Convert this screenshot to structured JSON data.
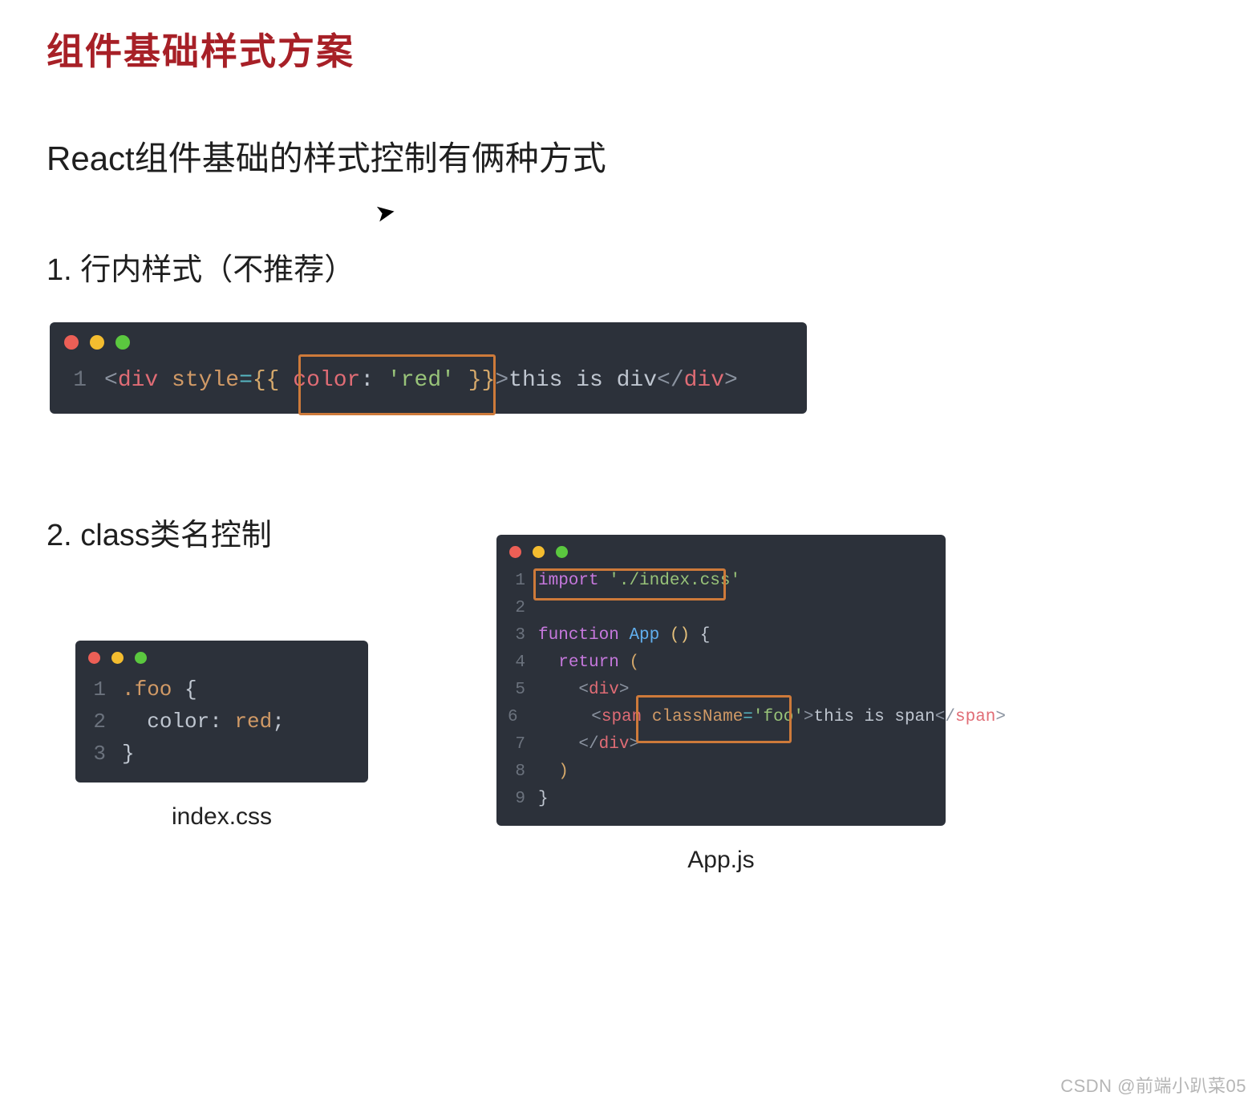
{
  "title": "组件基础样式方案",
  "subtitle": "React组件基础的样式控制有俩种方式",
  "cursor_glyph": "➤",
  "section1": {
    "heading": "1. 行内样式（不推荐）",
    "code": {
      "line_numbers": [
        "1"
      ],
      "tokens": {
        "lt": "<",
        "tag_div": "div",
        "sp": " ",
        "attr_style": "style",
        "eq": "=",
        "brace_open": "{{ ",
        "prop_color": "color",
        "colon": ": ",
        "str_red": "'red'",
        "brace_close": " }}",
        "gt": ">",
        "text": "this is div",
        "lt_close": "</",
        "tag_div2": "div",
        "gt2": ">"
      }
    }
  },
  "section2": {
    "heading": "2. class类名控制",
    "css": {
      "caption": "index.css",
      "line_numbers": [
        "1",
        "2",
        "3"
      ],
      "tokens": {
        "sel": ".foo",
        "sp": " ",
        "brace_open": "{",
        "indent": "  ",
        "prop": "color",
        "colon": ": ",
        "val": "red",
        "semi": ";",
        "brace_close": "}"
      }
    },
    "app": {
      "caption": "App.js",
      "line_numbers": [
        "1",
        "2",
        "3",
        "4",
        "5",
        "6",
        "7",
        "8",
        "9"
      ],
      "tokens": {
        "import": "import",
        "sp": " ",
        "str_css": "'./index.css'",
        "kw_function": "function",
        "fn_app": "App",
        "space": " ",
        "paren_open": "(",
        "paren_close": ")",
        "brace_open": "{",
        "indent2": "  ",
        "indent4": "    ",
        "indent6": "      ",
        "kw_return": "return",
        "ret_paren_open": "(",
        "lt": "<",
        "div": "div",
        "gt": ">",
        "span": "span",
        "attr_className": "className",
        "eq": "=",
        "str_foo": "'foo'",
        "span_text": "this is span",
        "lt_close": "</",
        "ret_paren_close": ")",
        "brace_close": "}"
      }
    }
  },
  "watermark": "CSDN @前端小趴菜05"
}
